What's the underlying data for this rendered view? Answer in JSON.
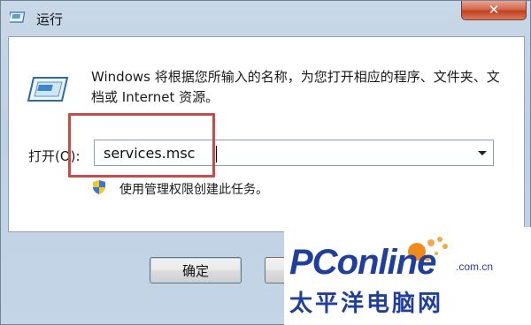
{
  "window": {
    "title": "运行",
    "close_glyph": "✕"
  },
  "dialog": {
    "description": "Windows 将根据您所输入的名称，为您打开相应的程序、文件夹、文档或 Internet 资源。",
    "open_label": "打开(O):",
    "input_value": "services.msc",
    "admin_note": "使用管理权限创建此任务。"
  },
  "buttons": {
    "ok_label": "确定",
    "cancel_label": ""
  },
  "watermark": {
    "logo": "PConline",
    "domain": ".com.cn",
    "chinese": "太平洋电脑网"
  },
  "icons": {
    "app": "run-dialog-icon",
    "big": "run-program-icon",
    "shield": "uac-shield-icon",
    "dropdown": "chevron-down-icon"
  },
  "colors": {
    "highlight": "#c94a4a",
    "close_button": "#c2411f",
    "watermark_blue": "#1f3f9a",
    "watermark_orange": "#f08a1c"
  }
}
